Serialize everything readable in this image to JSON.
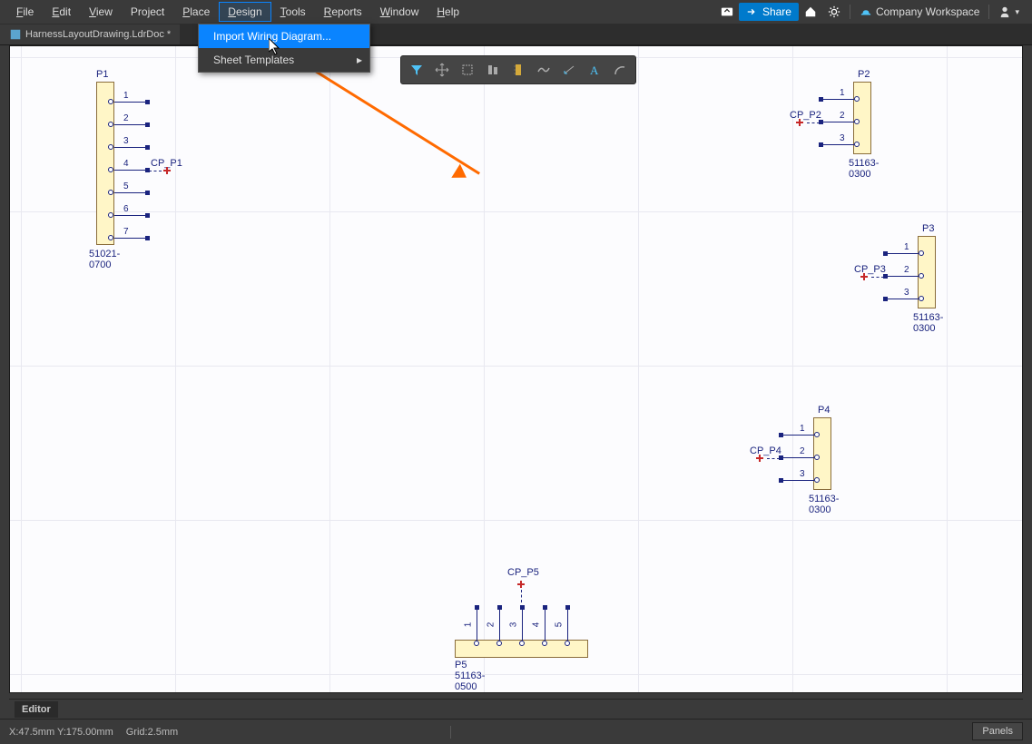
{
  "menu": {
    "items": [
      "File",
      "Edit",
      "View",
      "Project",
      "Place",
      "Design",
      "Tools",
      "Reports",
      "Window",
      "Help"
    ],
    "active_index": 5
  },
  "menubar_right": {
    "share": "Share",
    "workspace": "Company Workspace"
  },
  "tab": {
    "name": "HarnessLayoutDrawing.LdrDoc *"
  },
  "dropdown": {
    "items": [
      {
        "label": "Import Wiring Diagram...",
        "highlight": true,
        "submenu": false
      },
      {
        "label": "Sheet Templates",
        "highlight": false,
        "submenu": true
      }
    ]
  },
  "connectors": {
    "P1": {
      "name": "P1",
      "part": "51021-0700",
      "cp": "CP_P1",
      "pins": [
        "1",
        "2",
        "3",
        "4",
        "5",
        "6",
        "7"
      ]
    },
    "P2": {
      "name": "P2",
      "part": "51163-0300",
      "cp": "CP_P2",
      "pins": [
        "1",
        "2",
        "3"
      ]
    },
    "P3": {
      "name": "P3",
      "part": "51163-0300",
      "cp": "CP_P3",
      "pins": [
        "1",
        "2",
        "3"
      ]
    },
    "P4": {
      "name": "P4",
      "part": "51163-0300",
      "cp": "CP_P4",
      "pins": [
        "1",
        "2",
        "3"
      ]
    },
    "P5": {
      "name": "P5",
      "part": "51163-0500",
      "cp": "CP_P5",
      "pins": [
        "1",
        "2",
        "3",
        "4",
        "5"
      ]
    }
  },
  "editor_label": "Editor",
  "status": {
    "coord": "X:47.5mm Y:175.00mm",
    "grid": "Grid:2.5mm"
  },
  "panels_btn": "Panels"
}
